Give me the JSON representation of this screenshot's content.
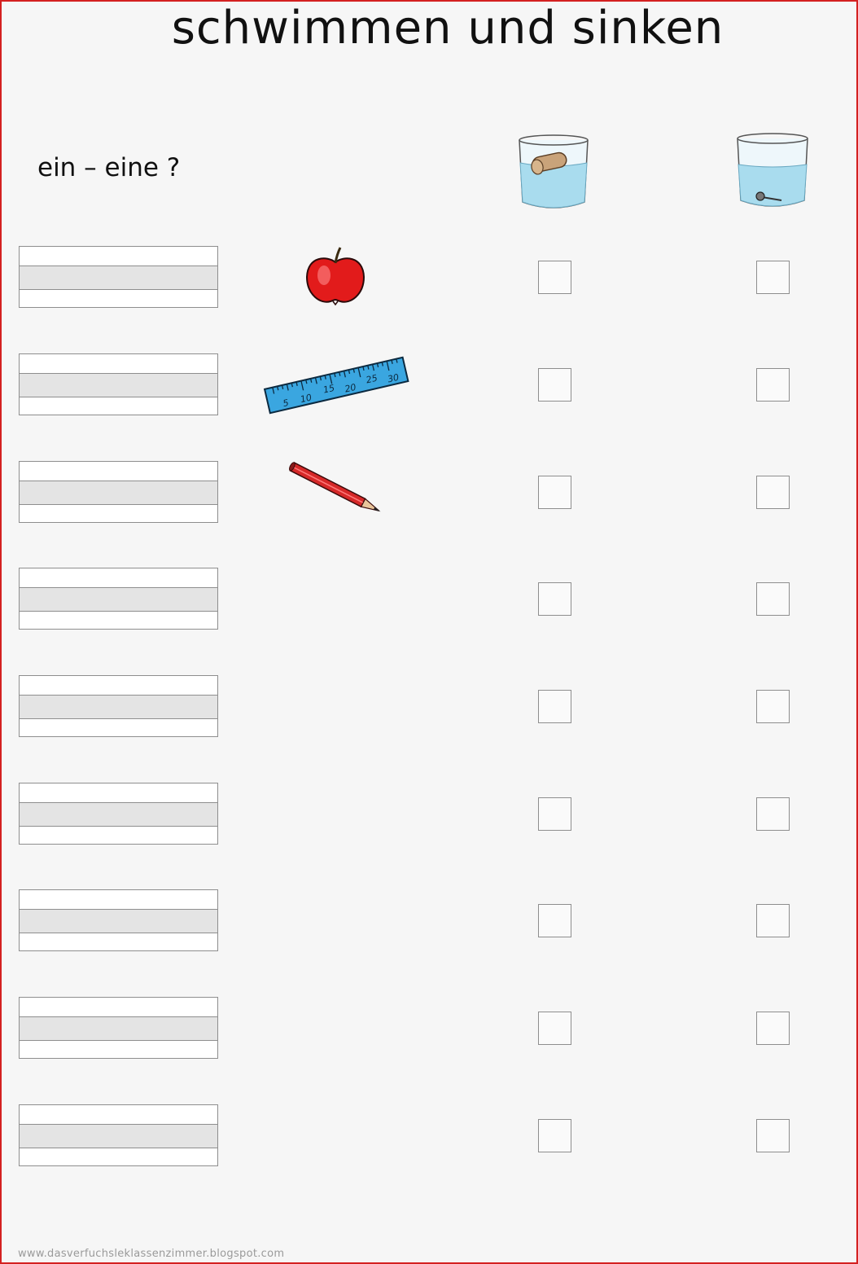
{
  "worksheet": {
    "title": "schwimmen und sinken",
    "subtitle": "ein – eine ?",
    "header_icons": [
      "floating-object-glass-icon",
      "sinking-object-glass-icon"
    ],
    "rows": [
      {
        "picture": "apple-icon"
      },
      {
        "picture": "ruler-icon",
        "ruler_marks": [
          "5",
          "10",
          "15",
          "20",
          "25",
          "30"
        ]
      },
      {
        "picture": "pencil-icon"
      },
      {
        "picture": ""
      },
      {
        "picture": ""
      },
      {
        "picture": ""
      },
      {
        "picture": ""
      },
      {
        "picture": ""
      },
      {
        "picture": ""
      }
    ],
    "footer": "www.dasverfuchsleklassenzimmer.blogspot.com"
  },
  "colors": {
    "frame": "#d42020",
    "water": "#a9dcee",
    "apple": "#e21b1b",
    "ruler": "#3aa6e0",
    "pencil": "#d62828"
  }
}
